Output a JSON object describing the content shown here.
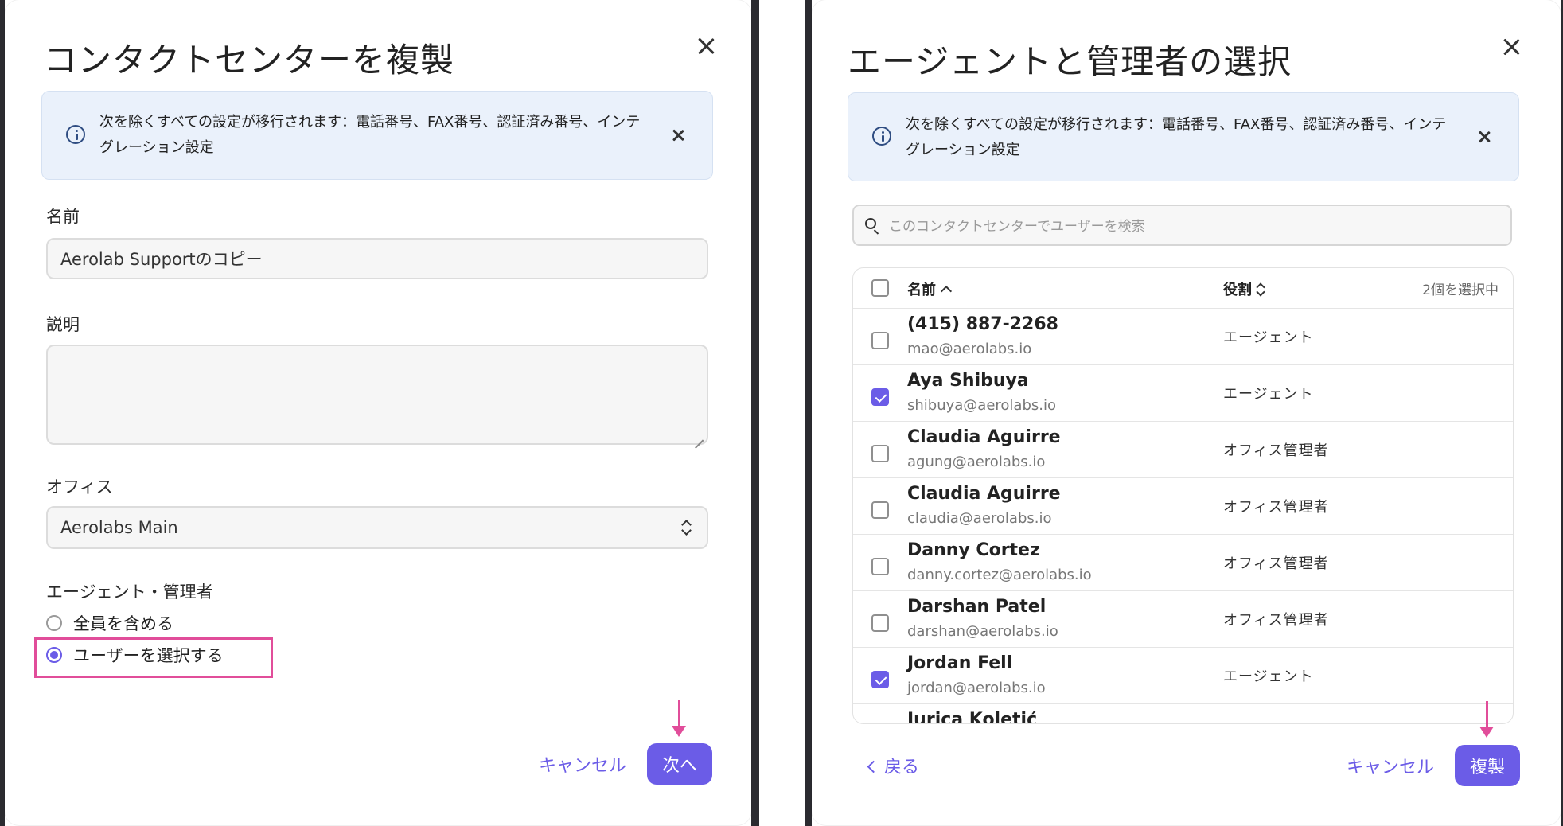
{
  "duplicate_modal": {
    "title": "コンタクトセンターを複製",
    "banner_text": "次を除くすべての設定が移行されます：電話番号、FAX番号、認証済み番号、インテグレーション設定",
    "name_label": "名前",
    "name_value": "Aerolab Supportのコピー",
    "description_label": "説明",
    "description_value": "",
    "office_label": "オフィス",
    "office_value": "Aerolabs Main",
    "agents_label": "エージェント・管理者",
    "options": [
      "全員を含める",
      "ユーザーを選択する"
    ],
    "selected_option": "ユーザーを選択する",
    "cancel_label": "キャンセル",
    "next_label": "次へ"
  },
  "select_modal": {
    "title": "エージェントと管理者の選択",
    "banner_text": "次を除くすべての設定が移行されます：電話番号、FAX番号、認証済み番号、インテグレーション設定",
    "search_placeholder": "このコンタクトセンターでユーザーを検索",
    "columns": {
      "name": "名前",
      "role": "役割"
    },
    "selected_count": "2個を選択中",
    "users": [
      {
        "name": "(415) 887-2268",
        "email": "mao@aerolabs.io",
        "role": "エージェント",
        "checked": false
      },
      {
        "name": "Aya Shibuya",
        "email": "shibuya@aerolabs.io",
        "role": "エージェント",
        "checked": true
      },
      {
        "name": "Claudia Aguirre",
        "email": "agung@aerolabs.io",
        "role": "オフィス管理者",
        "checked": false
      },
      {
        "name": "Claudia Aguirre",
        "email": "claudia@aerolabs.io",
        "role": "オフィス管理者",
        "checked": false
      },
      {
        "name": "Danny Cortez",
        "email": "danny.cortez@aerolabs.io",
        "role": "オフィス管理者",
        "checked": false
      },
      {
        "name": "Darshan Patel",
        "email": "darshan@aerolabs.io",
        "role": "オフィス管理者",
        "checked": false
      },
      {
        "name": "Jordan Fell",
        "email": "jordan@aerolabs.io",
        "role": "エージェント",
        "checked": true
      },
      {
        "name": "Jurica Koletić",
        "email": "",
        "role": "",
        "checked": false
      }
    ],
    "back_label": "戻る",
    "cancel_label": "キャンセル",
    "duplicate_label": "複製"
  },
  "colors": {
    "accent": "#6b5ce7",
    "annotation": "#e14d9a",
    "banner_bg": "#eaf1fb"
  },
  "icons": [
    "close-icon",
    "info-icon",
    "search-icon",
    "chevron-left-icon",
    "sort-icon",
    "updown-icon",
    "checkbox-icon",
    "radio-icon",
    "arrow-annotation"
  ]
}
